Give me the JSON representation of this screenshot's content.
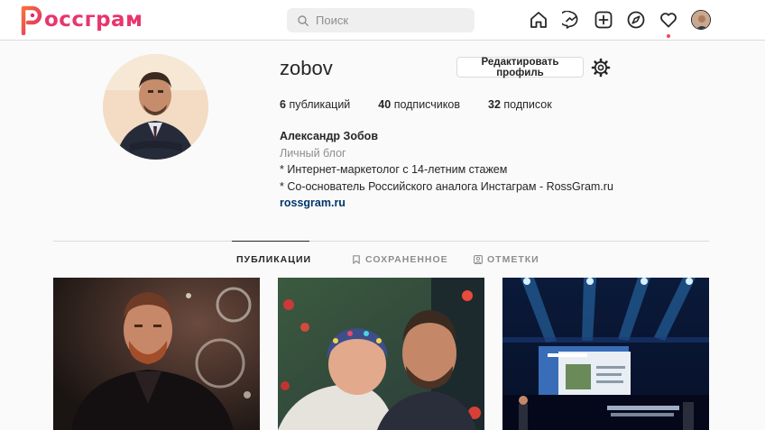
{
  "app": {
    "logo_text": "оссграм",
    "logo_letter": "Р",
    "brand_color": "#e8356d"
  },
  "search": {
    "placeholder": "Поиск",
    "value": ""
  },
  "nav": {
    "icons": [
      "home-icon",
      "messenger-icon",
      "new-post-icon",
      "explore-icon",
      "activity-heart-icon",
      "profile-avatar-icon"
    ],
    "activity_dot_color": "#ed4956"
  },
  "profile": {
    "username": "zobov",
    "edit_button": "Редактировать профиль",
    "stats": [
      {
        "count": "6",
        "label": "публикаций"
      },
      {
        "count": "40",
        "label": "подписчиков"
      },
      {
        "count": "32",
        "label": "подписок"
      }
    ],
    "full_name": "Александр Зобов",
    "category": "Личный блог",
    "bio_lines": [
      "* Интернет-маркетолог с 14-летним стажем",
      "* Со-основатель Российского аналога Инстаграм - RossGram.ru"
    ],
    "website": "rossgram.ru"
  },
  "tabs": [
    {
      "label": "ПУБЛИКАЦИИ",
      "icon": "grid-icon",
      "active": true
    },
    {
      "label": "СОХРАНЕННОЕ",
      "icon": "bookmark-icon",
      "active": false
    },
    {
      "label": "ОТМЕТКИ",
      "icon": "tag-icon",
      "active": false
    }
  ],
  "posts": [
    {
      "name": "post-man-christmas"
    },
    {
      "name": "post-couple-selfie"
    },
    {
      "name": "post-stage-event"
    }
  ]
}
